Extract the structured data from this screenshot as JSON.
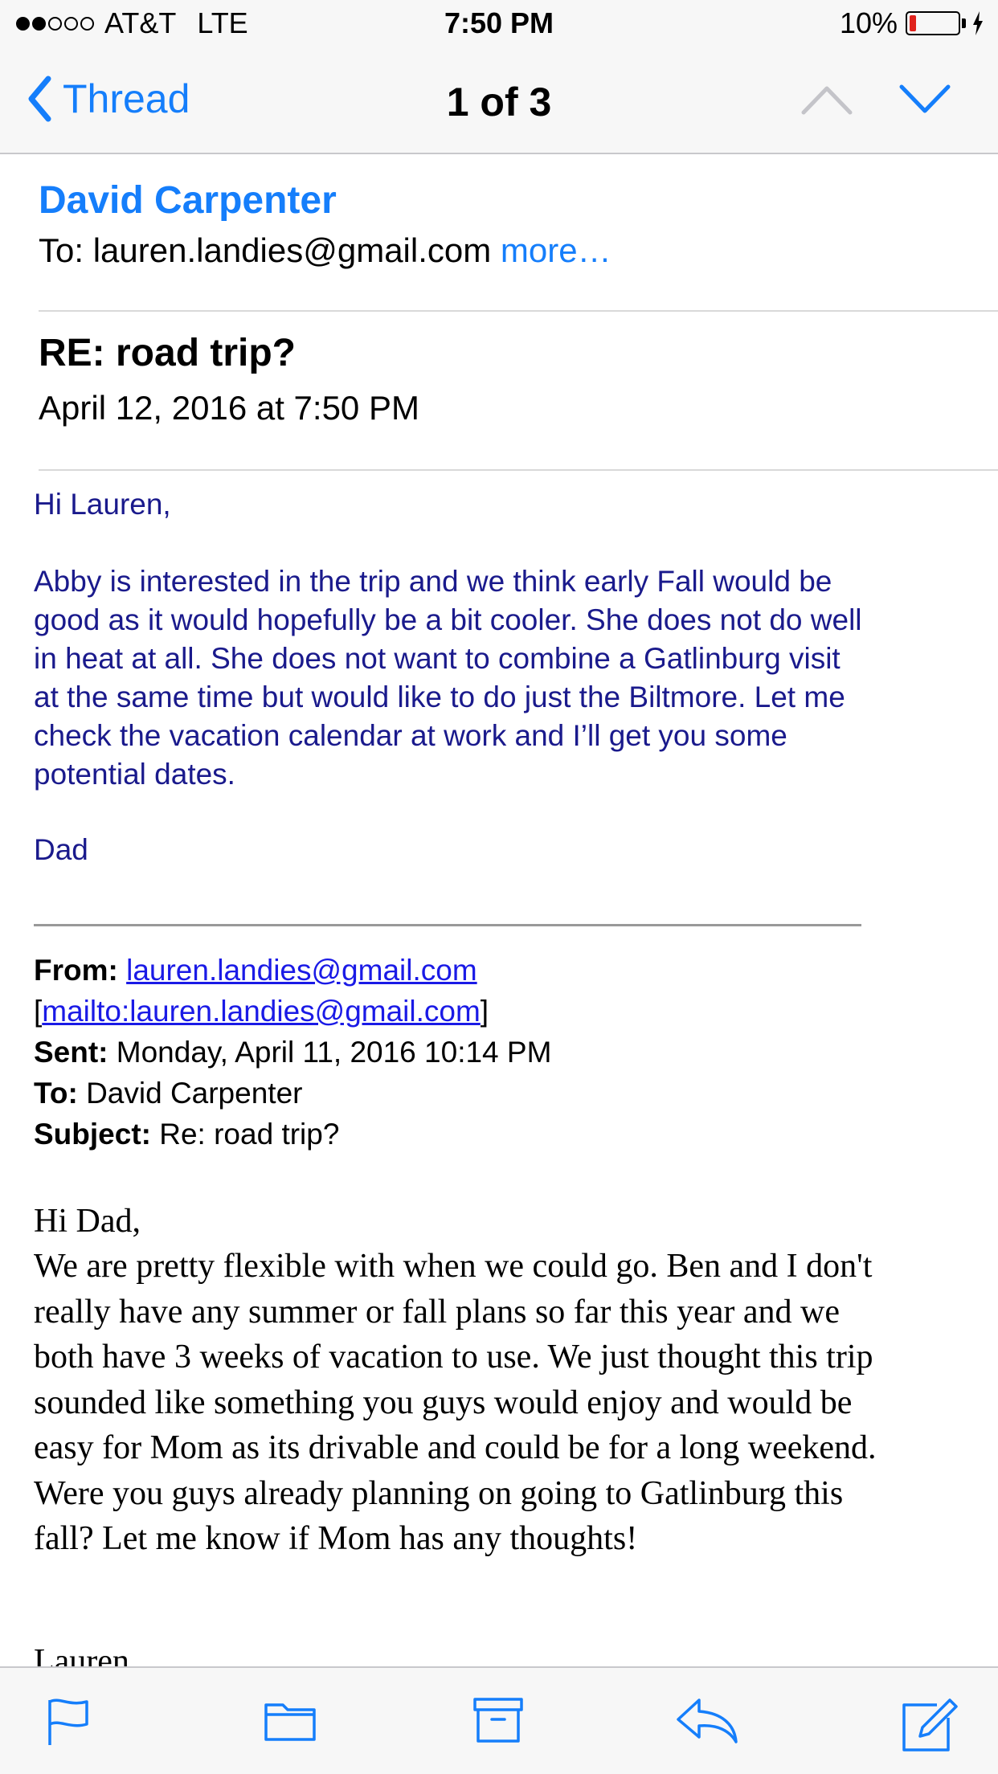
{
  "status_bar": {
    "carrier": "AT&T",
    "network": "LTE",
    "time": "7:50 PM",
    "battery": "10%",
    "signal_bars": 2,
    "battery_level": 0.1,
    "battery_color": "#e0231d"
  },
  "nav": {
    "back_label": "Thread",
    "title": "1 of 3"
  },
  "header": {
    "sender": "David Carpenter",
    "to_prefix": "To:",
    "to_address": "lauren.landies@gmail.com",
    "more": "more…",
    "subject": "RE: road trip?",
    "date": "April 12, 2016 at 7:50 PM"
  },
  "reply": {
    "greeting": "Hi Lauren,",
    "body": "Abby is interested in the trip and we think early Fall would be good as it would hopefully be a bit cooler. She does not do well in heat at all. She does not want to combine a Gatlinburg visit at the same time but would like to do just the Biltmore. Let me check the vacation calendar at work and I’ll get you some potential dates.",
    "signature": "Dad"
  },
  "quoted_header": {
    "from_label": "From:",
    "from_email": "lauren.landies@gmail.com",
    "mailto_open": "[",
    "mailto": "mailto:lauren.landies@gmail.com",
    "mailto_close": "]",
    "sent_label": "Sent:",
    "sent": "Monday, April 11, 2016 10:14 PM",
    "to_label": "To:",
    "to": "David Carpenter",
    "subject_label": "Subject:",
    "subject": "Re: road trip?"
  },
  "quoted": {
    "greeting": "Hi Dad,",
    "body": "We are pretty flexible with when we could go. Ben and I don't really have any summer or fall plans so far this year and we both have 3 weeks of vacation to use. We just thought this trip sounded like something you guys would enjoy and would be easy for Mom as its drivable and could be for a long weekend. Were you guys already planning on going to Gatlinburg this fall? Let me know if Mom has any thoughts!",
    "signoff": "Lauren"
  },
  "toolbar": {
    "icons": [
      "flag-icon",
      "folder-icon",
      "archive-icon",
      "reply-icon",
      "compose-icon"
    ]
  },
  "colors": {
    "accent": "#157efb",
    "quote_text": "#1a1a8c"
  }
}
